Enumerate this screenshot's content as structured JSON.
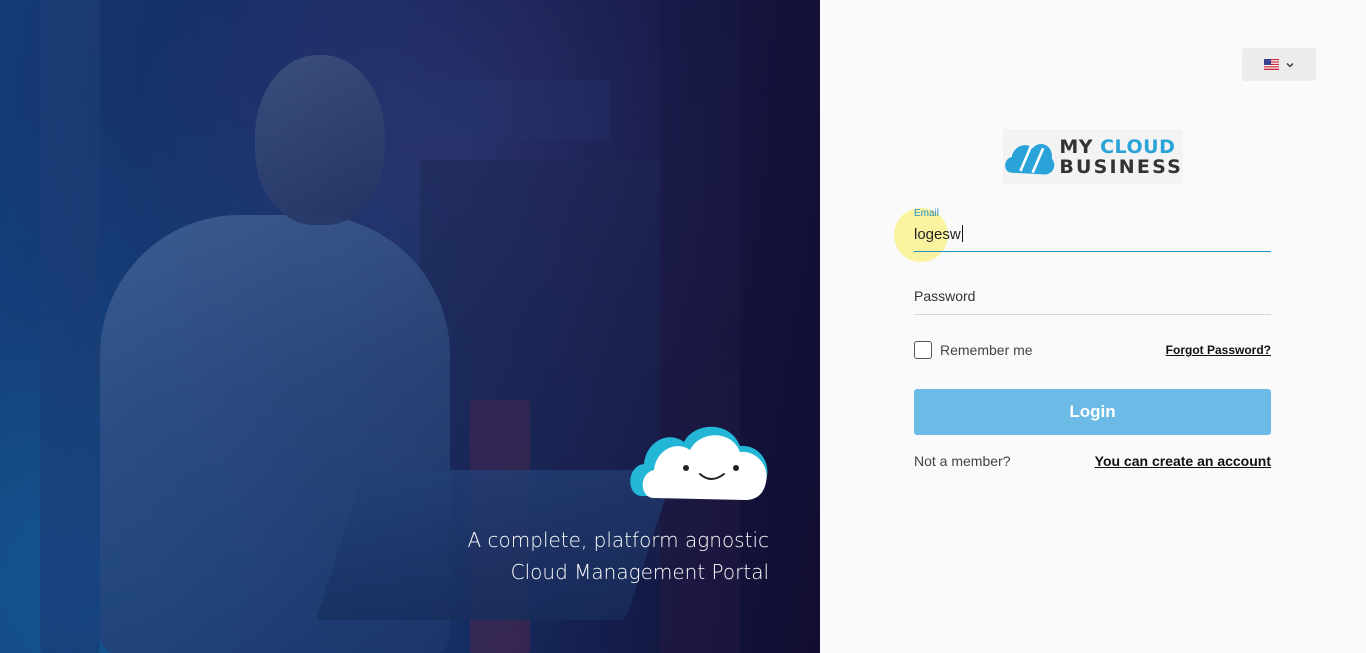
{
  "hero": {
    "tagline_line1": "A complete, platform agnostic",
    "tagline_line2": "Cloud Management Portal",
    "mascot_icon": "smiling-cloud-icon"
  },
  "language": {
    "flag_icon": "us-flag-icon",
    "dropdown_icon": "chevron-down-icon"
  },
  "logo": {
    "line1_part1": "MY ",
    "line1_part2": "CLOUD",
    "line2": "BUSINESS",
    "icon": "cloud-logo-icon",
    "brand_color": "#2aa3d8"
  },
  "form": {
    "email_label": "Email",
    "email_value": "logesw",
    "password_label": "Password",
    "remember_label": "Remember me",
    "remember_checked": false,
    "forgot_link": "Forgot Password?",
    "login_label": "Login",
    "login_color": "#6bbbe6",
    "not_member_text": "Not a member?",
    "create_link": "You can create an account"
  }
}
